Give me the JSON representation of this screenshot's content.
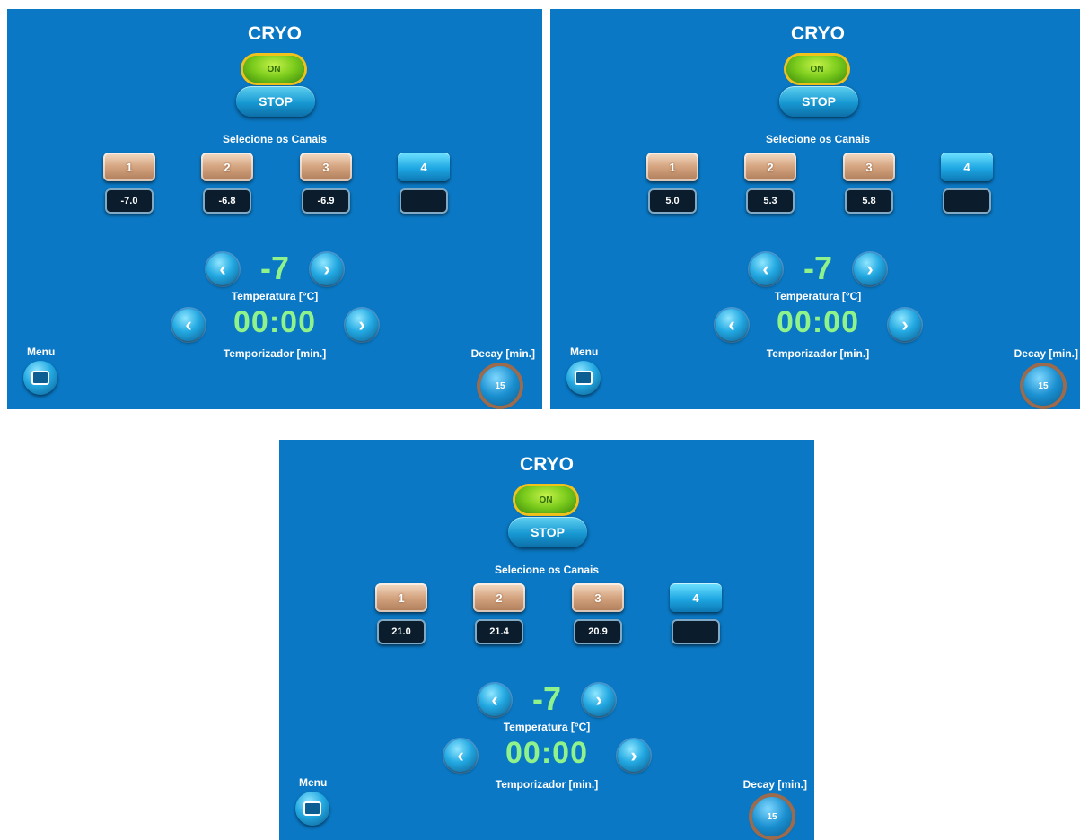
{
  "panels": [
    {
      "title": "CRYO",
      "on_label": "ON",
      "stop_label": "STOP",
      "select_label": "Selecione os Canais",
      "channels": [
        {
          "label": "1",
          "value": "-7.0",
          "active": false
        },
        {
          "label": "2",
          "value": "-6.8",
          "active": false
        },
        {
          "label": "3",
          "value": "-6.9",
          "active": false
        },
        {
          "label": "4",
          "value": "",
          "active": true
        }
      ],
      "temperature": "-7",
      "temperature_label": "Temperatura [°C]",
      "timer": "00:00",
      "timer_label": "Temporizador [min.]",
      "menu_label": "Menu",
      "decay_label": "Decay [min.]",
      "decay_value": "15"
    },
    {
      "title": "CRYO",
      "on_label": "ON",
      "stop_label": "STOP",
      "select_label": "Selecione os Canais",
      "channels": [
        {
          "label": "1",
          "value": "5.0",
          "active": false
        },
        {
          "label": "2",
          "value": "5.3",
          "active": false
        },
        {
          "label": "3",
          "value": "5.8",
          "active": false
        },
        {
          "label": "4",
          "value": "",
          "active": true
        }
      ],
      "temperature": "-7",
      "temperature_label": "Temperatura [°C]",
      "timer": "00:00",
      "timer_label": "Temporizador [min.]",
      "menu_label": "Menu",
      "decay_label": "Decay [min.]",
      "decay_value": "15"
    },
    {
      "title": "CRYO",
      "on_label": "ON",
      "stop_label": "STOP",
      "select_label": "Selecione os Canais",
      "channels": [
        {
          "label": "1",
          "value": "21.0",
          "active": false
        },
        {
          "label": "2",
          "value": "21.4",
          "active": false
        },
        {
          "label": "3",
          "value": "20.9",
          "active": false
        },
        {
          "label": "4",
          "value": "",
          "active": true
        }
      ],
      "temperature": "-7",
      "temperature_label": "Temperatura [°C]",
      "timer": "00:00",
      "timer_label": "Temporizador [min.]",
      "menu_label": "Menu",
      "decay_label": "Decay [min.]",
      "decay_value": "15"
    }
  ],
  "icons": {
    "left_arrow": "chevron-left-icon",
    "right_arrow": "chevron-right-icon",
    "menu": "screen-icon"
  },
  "colors": {
    "background": "#0a78c4",
    "on_green": "#7acb1c",
    "value_green": "#8ff28a",
    "channel_copper": "#d4a37f",
    "channel_active": "#1ea7e3"
  }
}
